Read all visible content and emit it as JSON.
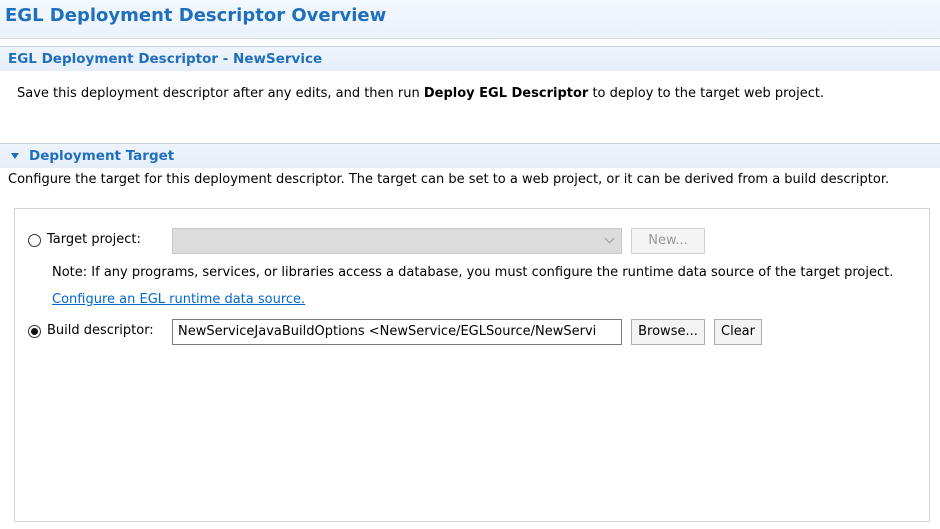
{
  "header": {
    "title": "EGL Deployment Descriptor Overview"
  },
  "descriptor_section": {
    "title": "EGL Deployment Descriptor - NewService",
    "description_pre": "Save this deployment descriptor after any edits, and then run ",
    "description_bold": "Deploy EGL Descriptor",
    "description_post": " to deploy to the target web project."
  },
  "target_section": {
    "title": "Deployment Target",
    "expanded": true,
    "description": "Configure the target for this deployment descriptor.  The target can be set to a web project, or it can be derived from a build descriptor."
  },
  "target_project": {
    "label": "Target project:",
    "selected": false,
    "combo_value": "",
    "enabled": false,
    "new_button": "New..."
  },
  "note": "Note: If any programs, services, or libraries access a database, you must configure the runtime data source of the target project.",
  "configure_link": "Configure an EGL runtime data source.",
  "build_descriptor": {
    "label": "Build descriptor:",
    "selected": true,
    "value": "NewServiceJavaBuildOptions <NewService/EGLSource/NewServi",
    "browse_button": "Browse...",
    "clear_button": "Clear"
  },
  "colors": {
    "accent": "#1f6fbf",
    "link": "#0066cc"
  }
}
